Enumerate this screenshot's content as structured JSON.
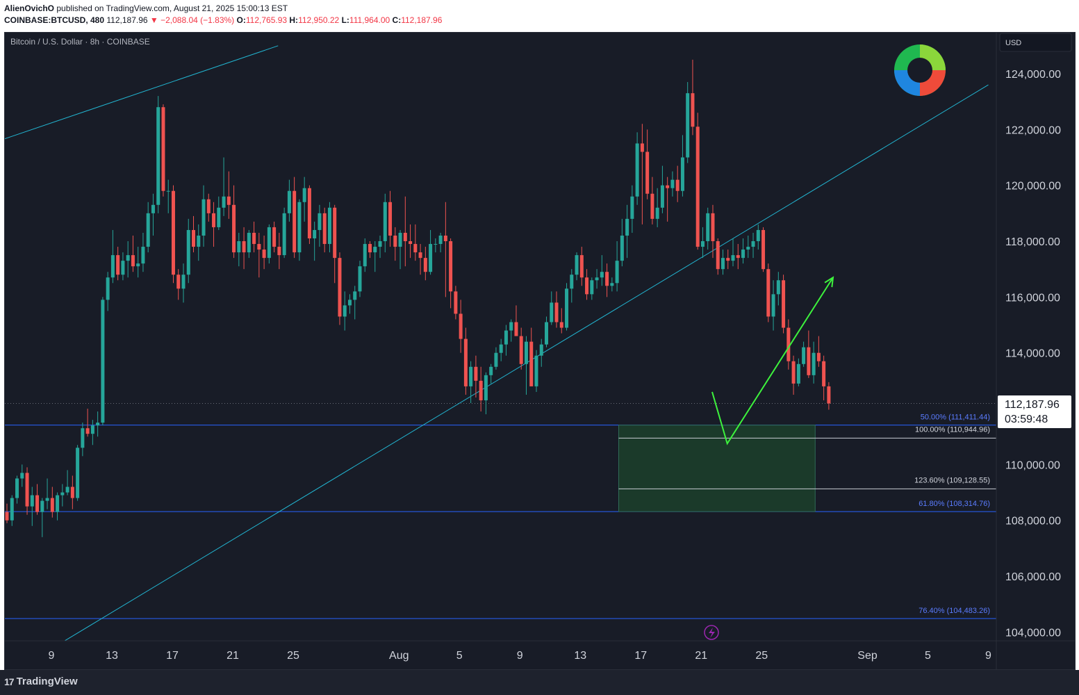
{
  "header": {
    "author": "AlienOvichO",
    "published_text": "published on TradingView.com, August 21, 2025 15:00:13 EST",
    "symbol": "COINBASE:BTCUSD, 480",
    "last": "112,187.96",
    "change": "▼ −2,088.04 (−1.83%)",
    "open_label": "O:",
    "open": "112,765.93",
    "high_label": "H:",
    "high": "112,950.22",
    "low_label": "L:",
    "low": "111,964.00",
    "close_label": "C:",
    "close": "112,187.96"
  },
  "chart_title": "Bitcoin / U.S. Dollar · 8h · COINBASE",
  "currency": "USD",
  "price_label": "112,187.96",
  "countdown": "03:59:48",
  "footer": {
    "brand": "TradingView",
    "brand_mark": "17"
  },
  "colors": {
    "background": "#181c27",
    "up": "#26a69a",
    "down": "#ef5350",
    "trend_line": "#22b5d1",
    "level_line": "#2962ff",
    "fib_text": "#5b7cff",
    "zone_fill": "#1b3a2a",
    "projection": "#3df23d"
  },
  "chart_data": {
    "type": "candlestick",
    "title": "Bitcoin / U.S. Dollar · 8h · COINBASE",
    "ylim": [
      103400,
      125200
    ],
    "y_ticks": [
      "104,000.00",
      "106,000.00",
      "108,000.00",
      "110,000.00",
      "112,000.00",
      "114,000.00",
      "116,000.00",
      "118,000.00",
      "120,000.00",
      "122,000.00",
      "124,000.00"
    ],
    "y_tick_values": [
      104000,
      106000,
      108000,
      110000,
      112000,
      114000,
      116000,
      118000,
      120000,
      122000,
      124000
    ],
    "x_ticks": [
      {
        "label": "9",
        "date": "2025-07-09"
      },
      {
        "label": "13",
        "date": "2025-07-13"
      },
      {
        "label": "17",
        "date": "2025-07-17"
      },
      {
        "label": "21",
        "date": "2025-07-21"
      },
      {
        "label": "25",
        "date": "2025-07-25"
      },
      {
        "label": "Aug",
        "date": "2025-08-01"
      },
      {
        "label": "5",
        "date": "2025-08-05"
      },
      {
        "label": "9",
        "date": "2025-08-09"
      },
      {
        "label": "13",
        "date": "2025-08-13"
      },
      {
        "label": "17",
        "date": "2025-08-17"
      },
      {
        "label": "21",
        "date": "2025-08-21"
      },
      {
        "label": "25",
        "date": "2025-08-25"
      },
      {
        "label": "Sep",
        "date": "2025-09-01"
      },
      {
        "label": "5",
        "date": "2025-09-05"
      },
      {
        "label": "9",
        "date": "2025-09-09"
      }
    ],
    "candles": [
      [
        108300,
        108600,
        107900,
        108000
      ],
      [
        108000,
        108900,
        107800,
        108800
      ],
      [
        108800,
        109600,
        108600,
        109500
      ],
      [
        109500,
        110000,
        109200,
        109700
      ],
      [
        109700,
        109900,
        108200,
        108500
      ],
      [
        108500,
        109200,
        107800,
        108900
      ],
      [
        108900,
        109300,
        108200,
        108300
      ],
      [
        108300,
        108800,
        107400,
        108700
      ],
      [
        108700,
        109500,
        108400,
        108800
      ],
      [
        108800,
        109200,
        108100,
        108300
      ],
      [
        108300,
        109000,
        108000,
        108900
      ],
      [
        108900,
        109300,
        108500,
        109000
      ],
      [
        109000,
        109800,
        108900,
        109200
      ],
      [
        109200,
        109600,
        108400,
        108800
      ],
      [
        108800,
        110700,
        108700,
        110600
      ],
      [
        110600,
        111500,
        110300,
        111300
      ],
      [
        111300,
        112000,
        111000,
        111100
      ],
      [
        111100,
        111600,
        110700,
        111400
      ],
      [
        111400,
        111900,
        111000,
        111500
      ],
      [
        111500,
        116000,
        111400,
        115900
      ],
      [
        115900,
        116900,
        115500,
        116700
      ],
      [
        116700,
        118400,
        116500,
        117500
      ],
      [
        117500,
        117800,
        116600,
        116800
      ],
      [
        116800,
        117600,
        116600,
        117300
      ],
      [
        117300,
        118000,
        116700,
        117500
      ],
      [
        117500,
        118200,
        116900,
        117100
      ],
      [
        117100,
        117800,
        116700,
        117200
      ],
      [
        117200,
        118300,
        116900,
        117800
      ],
      [
        117800,
        119400,
        117600,
        119000
      ],
      [
        119000,
        119700,
        118200,
        119300
      ],
      [
        119300,
        123200,
        119000,
        122800
      ],
      [
        122800,
        122900,
        119600,
        119800
      ],
      [
        119800,
        120200,
        119000,
        119800
      ],
      [
        119800,
        120000,
        116500,
        116800
      ],
      [
        116800,
        117000,
        115900,
        116300
      ],
      [
        116300,
        117200,
        115800,
        116800
      ],
      [
        116800,
        118800,
        116500,
        118400
      ],
      [
        118400,
        118900,
        117600,
        117800
      ],
      [
        117800,
        118600,
        117300,
        118200
      ],
      [
        118200,
        120000,
        117800,
        119500
      ],
      [
        119500,
        119700,
        118700,
        119000
      ],
      [
        119000,
        119400,
        117800,
        118500
      ],
      [
        118500,
        119600,
        118400,
        119200
      ],
      [
        119200,
        121000,
        118900,
        119600
      ],
      [
        119600,
        120500,
        118800,
        119300
      ],
      [
        119300,
        120000,
        117400,
        117600
      ],
      [
        117600,
        118300,
        117100,
        118000
      ],
      [
        118000,
        118500,
        117000,
        117600
      ],
      [
        117600,
        118400,
        117400,
        118300
      ],
      [
        118300,
        118700,
        117600,
        117900
      ],
      [
        117900,
        118300,
        116700,
        117700
      ],
      [
        117700,
        118200,
        117000,
        117400
      ],
      [
        117400,
        118600,
        117200,
        118500
      ],
      [
        118500,
        118700,
        117600,
        117800
      ],
      [
        117800,
        118300,
        117000,
        117500
      ],
      [
        117500,
        119200,
        117400,
        119000
      ],
      [
        119000,
        120200,
        118700,
        119800
      ],
      [
        119800,
        120300,
        117400,
        117600
      ],
      [
        117600,
        119500,
        117300,
        119400
      ],
      [
        119400,
        120300,
        118700,
        119900
      ],
      [
        119900,
        120000,
        117900,
        118100
      ],
      [
        118100,
        118700,
        117300,
        118400
      ],
      [
        118400,
        119300,
        117800,
        119000
      ],
      [
        119000,
        119200,
        117600,
        117900
      ],
      [
        117900,
        119400,
        117600,
        119200
      ],
      [
        119200,
        119300,
        116500,
        117400
      ],
      [
        117400,
        117600,
        115000,
        115300
      ],
      [
        115300,
        116200,
        114800,
        115700
      ],
      [
        115700,
        116100,
        115400,
        115900
      ],
      [
        115900,
        116400,
        115200,
        116200
      ],
      [
        116200,
        117300,
        116000,
        117100
      ],
      [
        117100,
        118100,
        116900,
        117900
      ],
      [
        117900,
        118000,
        117400,
        117600
      ],
      [
        117600,
        118000,
        116900,
        117800
      ],
      [
        117800,
        118200,
        117400,
        118000
      ],
      [
        118000,
        119700,
        117600,
        119400
      ],
      [
        119400,
        119800,
        117800,
        118200
      ],
      [
        118200,
        118500,
        117300,
        117800
      ],
      [
        117800,
        118400,
        117000,
        118300
      ],
      [
        118300,
        119600,
        117100,
        118000
      ],
      [
        118000,
        118600,
        117400,
        117900
      ],
      [
        117900,
        118600,
        117300,
        117600
      ],
      [
        117600,
        117900,
        116800,
        117400
      ],
      [
        117400,
        117800,
        116600,
        116900
      ],
      [
        116900,
        118400,
        116800,
        117900
      ],
      [
        117900,
        118100,
        117600,
        117900
      ],
      [
        117900,
        118300,
        117600,
        118200
      ],
      [
        118200,
        119400,
        116000,
        118000
      ],
      [
        118000,
        118100,
        115600,
        116200
      ],
      [
        116200,
        116400,
        115200,
        115400
      ],
      [
        115400,
        115900,
        114000,
        114500
      ],
      [
        114500,
        114900,
        112500,
        112800
      ],
      [
        112800,
        113700,
        112200,
        113500
      ],
      [
        113500,
        113900,
        112400,
        113000
      ],
      [
        113000,
        113500,
        111900,
        112300
      ],
      [
        112300,
        113300,
        111800,
        113200
      ],
      [
        113200,
        113600,
        112900,
        113500
      ],
      [
        113500,
        114200,
        113400,
        114000
      ],
      [
        114000,
        114500,
        113700,
        114300
      ],
      [
        114300,
        115000,
        113900,
        114800
      ],
      [
        114800,
        115200,
        114400,
        115100
      ],
      [
        115100,
        115700,
        114700,
        114600
      ],
      [
        114600,
        114900,
        113400,
        113600
      ],
      [
        113600,
        114600,
        112500,
        114400
      ],
      [
        114400,
        114900,
        112900,
        112800
      ],
      [
        112800,
        114100,
        112600,
        113900
      ],
      [
        113900,
        114500,
        113500,
        114300
      ],
      [
        114300,
        115300,
        114200,
        115100
      ],
      [
        115100,
        116200,
        115000,
        115800
      ],
      [
        115800,
        116200,
        114900,
        115100
      ],
      [
        115100,
        115600,
        114700,
        114900
      ],
      [
        114900,
        116500,
        114800,
        116300
      ],
      [
        116300,
        117000,
        115800,
        116800
      ],
      [
        116800,
        117600,
        116600,
        117500
      ],
      [
        117500,
        117800,
        116400,
        116700
      ],
      [
        116700,
        117000,
        115900,
        116100
      ],
      [
        116100,
        116700,
        115900,
        116600
      ],
      [
        116600,
        117000,
        116300,
        116700
      ],
      [
        116700,
        117500,
        116400,
        116900
      ],
      [
        116900,
        117200,
        116000,
        116400
      ],
      [
        116400,
        116700,
        116200,
        116500
      ],
      [
        116500,
        118000,
        116200,
        117300
      ],
      [
        117300,
        118800,
        117100,
        118200
      ],
      [
        118200,
        119300,
        117400,
        118800
      ],
      [
        118800,
        120000,
        118300,
        119600
      ],
      [
        119600,
        121900,
        119300,
        121500
      ],
      [
        121500,
        122200,
        118600,
        121200
      ],
      [
        121200,
        122000,
        119500,
        119700
      ],
      [
        119700,
        120300,
        118600,
        118800
      ],
      [
        118800,
        119900,
        118500,
        119200
      ],
      [
        119200,
        120700,
        119000,
        120000
      ],
      [
        120000,
        120300,
        118700,
        119900
      ],
      [
        119900,
        120500,
        119600,
        120200
      ],
      [
        120200,
        120700,
        119400,
        119800
      ],
      [
        119800,
        121800,
        119600,
        121000
      ],
      [
        121000,
        123700,
        120800,
        123300
      ],
      [
        123300,
        124500,
        121800,
        122100
      ],
      [
        122100,
        122600,
        117700,
        117800
      ],
      [
        117800,
        118500,
        117400,
        118000
      ],
      [
        118000,
        119200,
        117700,
        119000
      ],
      [
        119000,
        119300,
        117400,
        118000
      ],
      [
        118000,
        118100,
        116800,
        117000
      ],
      [
        117000,
        117700,
        116800,
        117400
      ],
      [
        117400,
        117700,
        117000,
        117300
      ],
      [
        117300,
        118100,
        117100,
        117500
      ],
      [
        117500,
        117900,
        117000,
        117400
      ],
      [
        117400,
        118100,
        117200,
        117700
      ],
      [
        117700,
        118200,
        117400,
        117800
      ],
      [
        117800,
        118300,
        117400,
        118000
      ],
      [
        118000,
        118600,
        117700,
        118400
      ],
      [
        118400,
        118500,
        116900,
        117000
      ],
      [
        117000,
        117200,
        115100,
        115300
      ],
      [
        115300,
        116600,
        114800,
        116100
      ],
      [
        116100,
        116900,
        115700,
        116600
      ],
      [
        116600,
        116800,
        114700,
        114900
      ],
      [
        114900,
        115200,
        113400,
        113700
      ],
      [
        113700,
        113900,
        112500,
        112900
      ],
      [
        112900,
        113800,
        112800,
        113600
      ],
      [
        113600,
        114400,
        113500,
        114200
      ],
      [
        114200,
        114800,
        113100,
        113200
      ],
      [
        113200,
        114400,
        112900,
        114000
      ],
      [
        114000,
        114600,
        113500,
        113700
      ],
      [
        113700,
        113900,
        112300,
        112800
      ],
      [
        112800,
        112950,
        111964,
        112188
      ]
    ],
    "candles_format": "[open, high, low, close]",
    "horizontal_levels": [
      {
        "label": "50.00% (111,411.44)",
        "value": 111411.44
      },
      {
        "label": "61.80% (108,314.76)",
        "value": 108314.76
      },
      {
        "label": "76.40% (104,483.26)",
        "value": 104483.26
      }
    ],
    "zone_levels": [
      {
        "label": "100.00% (110,944.96)",
        "value": 110944.96
      },
      {
        "label": "123.60% (109,128.55)",
        "value": 109128.55
      }
    ],
    "zone": {
      "top": 111411.44,
      "bottom": 108314.76,
      "start_date": "2025-08-16",
      "end_date": "2025-08-29"
    },
    "trend_lines": [
      {
        "from": {
          "date": "2025-07-05",
          "price": 121500
        },
        "to": {
          "date": "2025-07-24",
          "price": 125000
        }
      },
      {
        "from": {
          "date": "2025-07-09",
          "price": 103400
        },
        "to": {
          "date": "2025-09-09",
          "price": 123600
        }
      }
    ],
    "projection": [
      {
        "date": "2025-08-22",
        "price": 112600
      },
      {
        "date": "2025-08-23",
        "price": 110750
      },
      {
        "date": "2025-08-30",
        "price": 116700
      }
    ],
    "current_price": 112187.96
  }
}
